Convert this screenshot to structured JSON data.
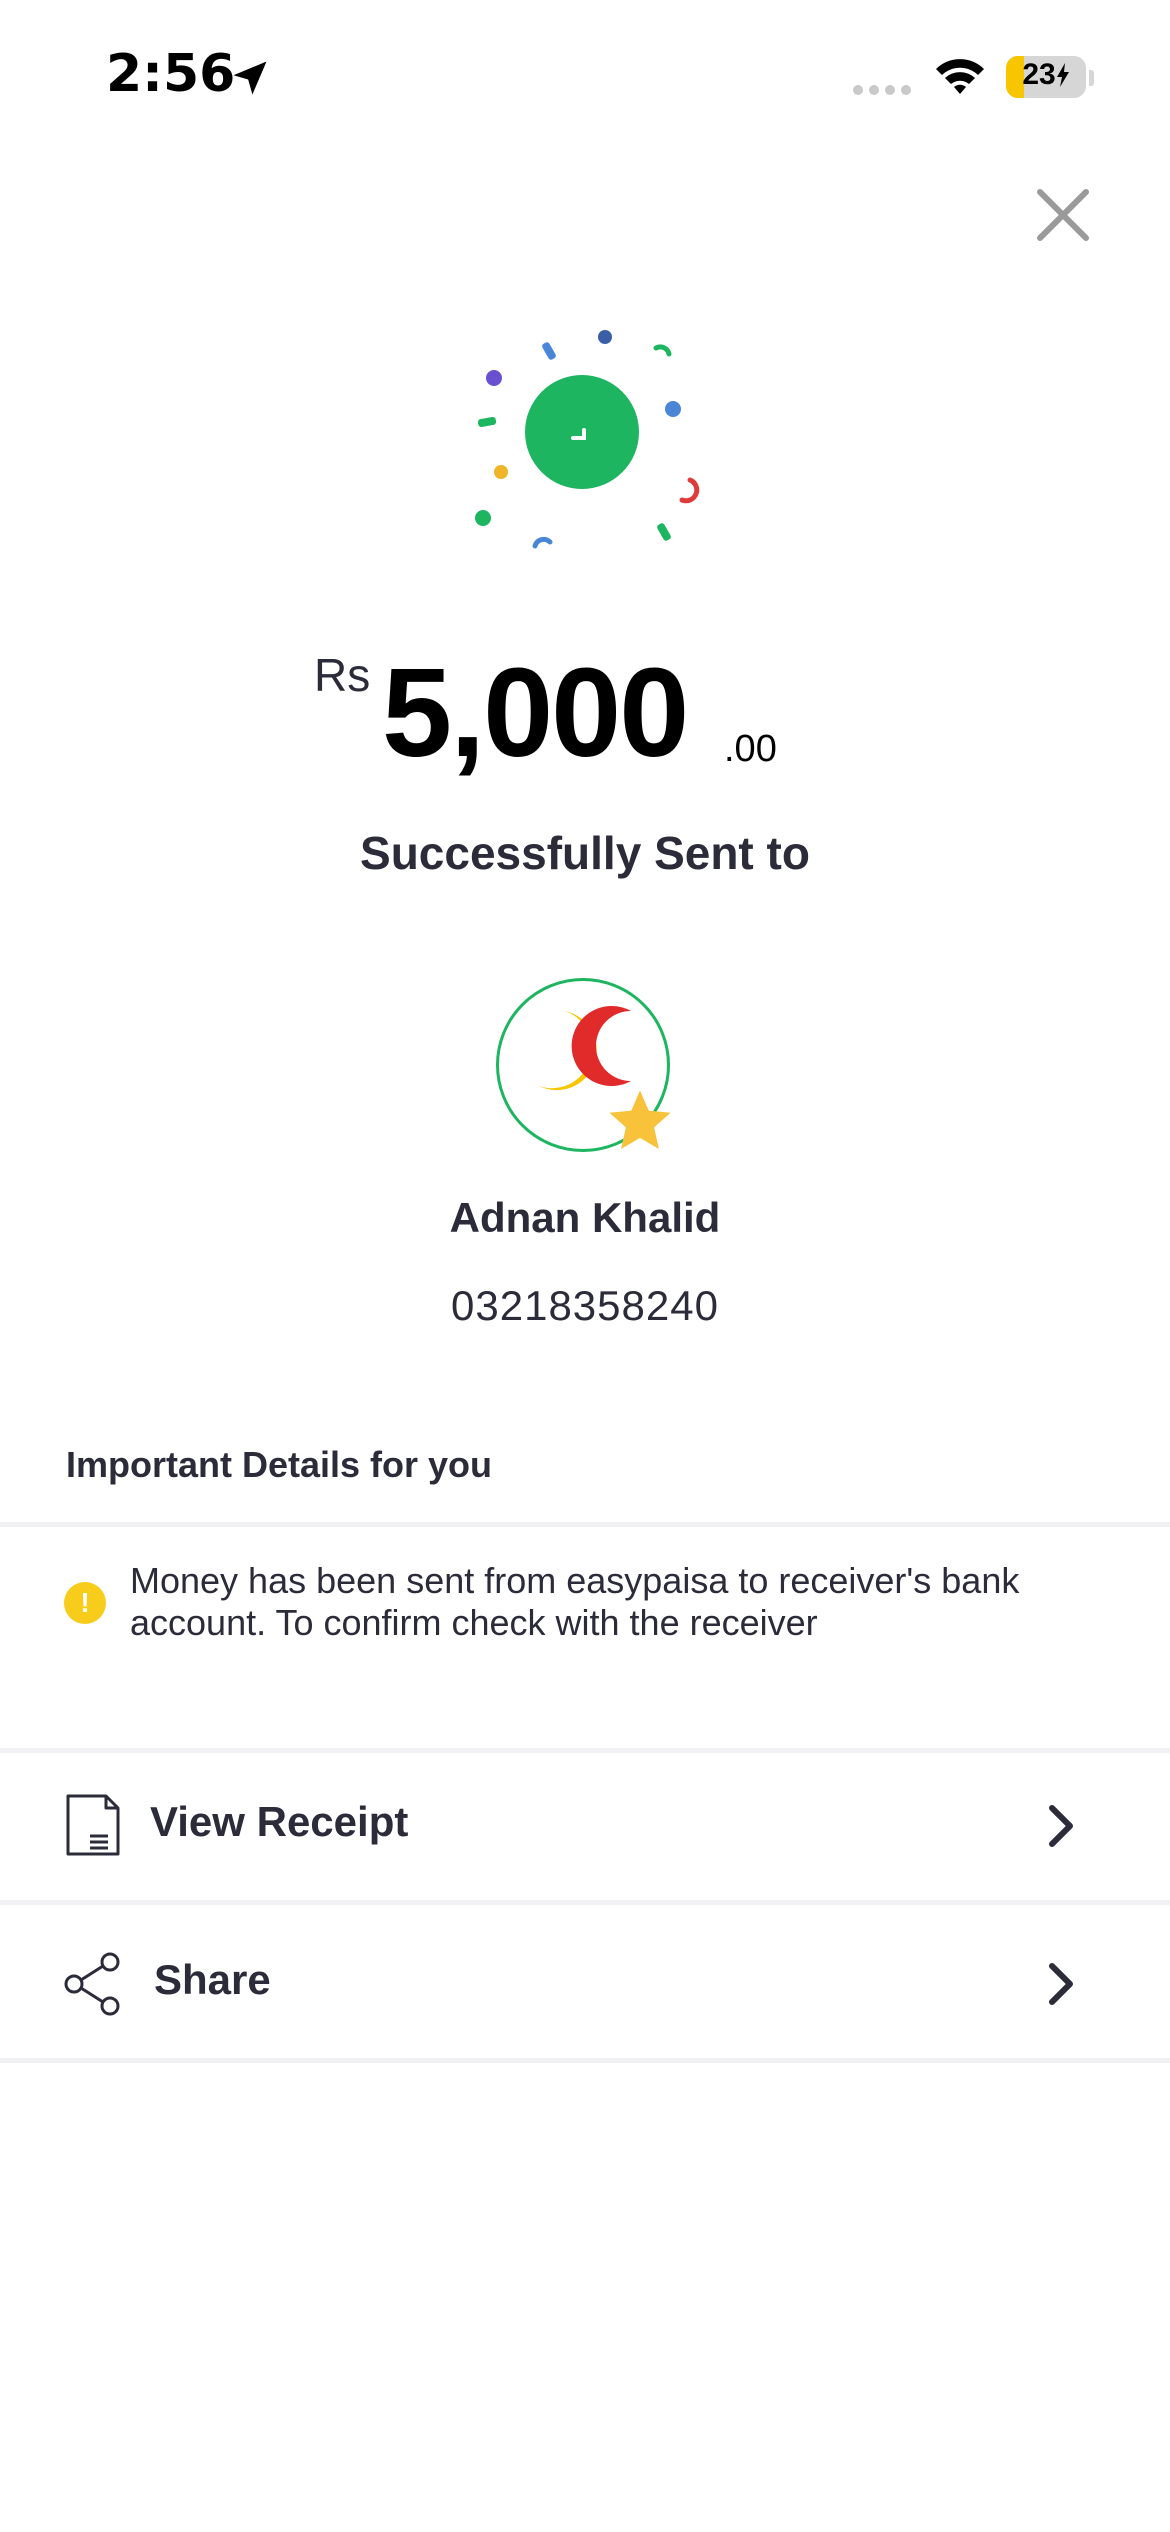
{
  "status_bar": {
    "time": "2:56",
    "battery_level": "23",
    "battery_fraction": 0.23,
    "location_icon": "location-arrow-icon",
    "signal_icon": "cellular-signal-icon",
    "wifi_icon": "wifi-icon",
    "charging_icon": "charging-bolt-icon"
  },
  "header": {
    "close_icon": "close-icon"
  },
  "success": {
    "icon": "success-check-icon",
    "currency": "Rs",
    "amount": "5,000",
    "decimal": ".00",
    "title": "Successfully Sent to"
  },
  "recipient": {
    "name": "Adnan Khalid",
    "number": "03218358240",
    "avatar_icon": "bank-logo-icon",
    "badge_icon": "star-icon"
  },
  "details": {
    "heading": "Important Details for you",
    "info_icon": "warning-icon",
    "info_text": "Money has been sent from easypaisa to receiver's bank account. To confirm check with the receiver"
  },
  "actions": [
    {
      "label": "View Receipt",
      "icon": "receipt-icon"
    },
    {
      "label": "Share",
      "icon": "share-icon"
    }
  ],
  "colors": {
    "brand_green": "#1db560",
    "warning_yellow": "#f8cc1b",
    "text_dark": "#2b2b3a"
  }
}
